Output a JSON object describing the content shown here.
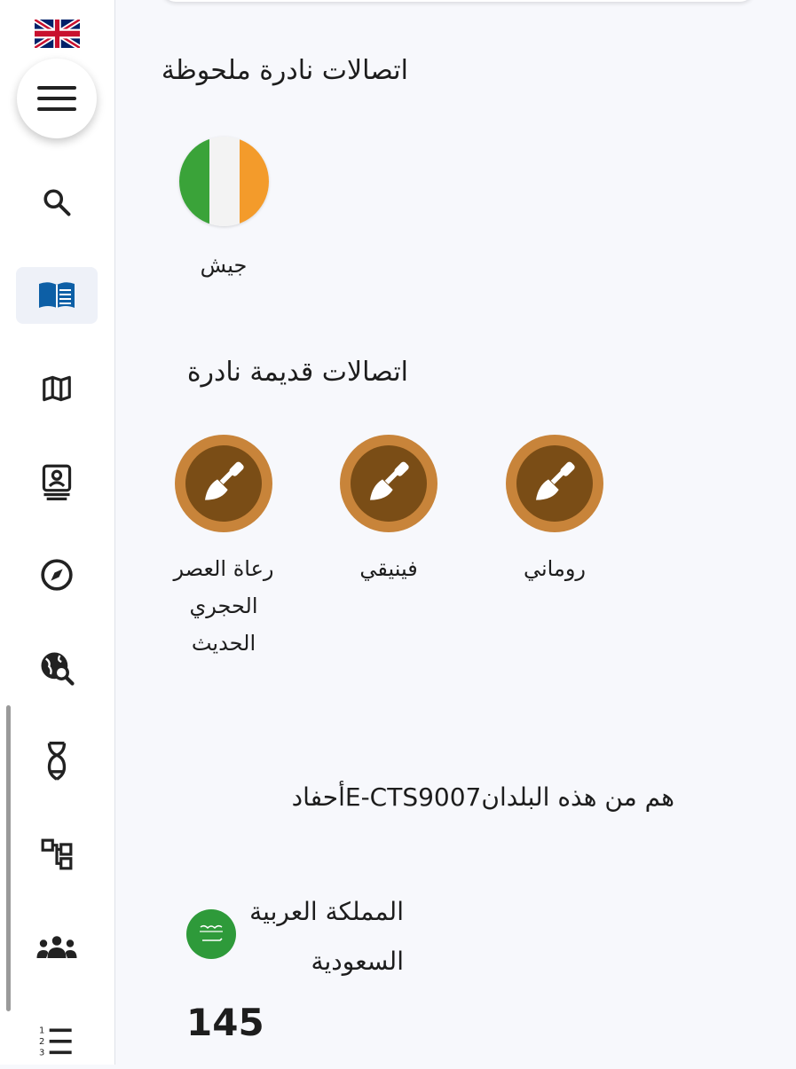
{
  "sidebar": {
    "language_flag": "uk-flag-icon",
    "items": [
      {
        "name": "search",
        "icon": "search-icon"
      },
      {
        "name": "book",
        "icon": "book-icon",
        "active": true
      },
      {
        "name": "map",
        "icon": "map-icon"
      },
      {
        "name": "contact",
        "icon": "contact-card-icon"
      },
      {
        "name": "compass",
        "icon": "compass-icon"
      },
      {
        "name": "globe-search",
        "icon": "globe-search-icon"
      },
      {
        "name": "dna",
        "icon": "dna-icon"
      },
      {
        "name": "tree",
        "icon": "tree-icon"
      },
      {
        "name": "people",
        "icon": "people-icon"
      },
      {
        "name": "ordered-list",
        "icon": "ordered-list-icon"
      }
    ]
  },
  "notable_rare": {
    "title": "اتصالات نادرة ملحوظة",
    "items": [
      {
        "label": "جيش",
        "flag": "ireland-flag-icon"
      }
    ]
  },
  "ancient_rare": {
    "title": "اتصالات قديمة نادرة",
    "items": [
      {
        "label": "روماني"
      },
      {
        "label": "فينيقي"
      },
      {
        "label": "رعاة العصر الحجري الحديث"
      }
    ]
  },
  "descendants": {
    "text": "هم من هذه البلدانE-CTS9007أحفاد",
    "countries": [
      {
        "name": "المملكة العربية السعودية",
        "count": "145",
        "flag": "saudi-flag-icon"
      }
    ]
  },
  "colors": {
    "accent": "#0d5fa6",
    "trowel_outer": "#c8843a",
    "trowel_inner": "#7a4d16",
    "saudi_green": "#2e9a3a"
  }
}
